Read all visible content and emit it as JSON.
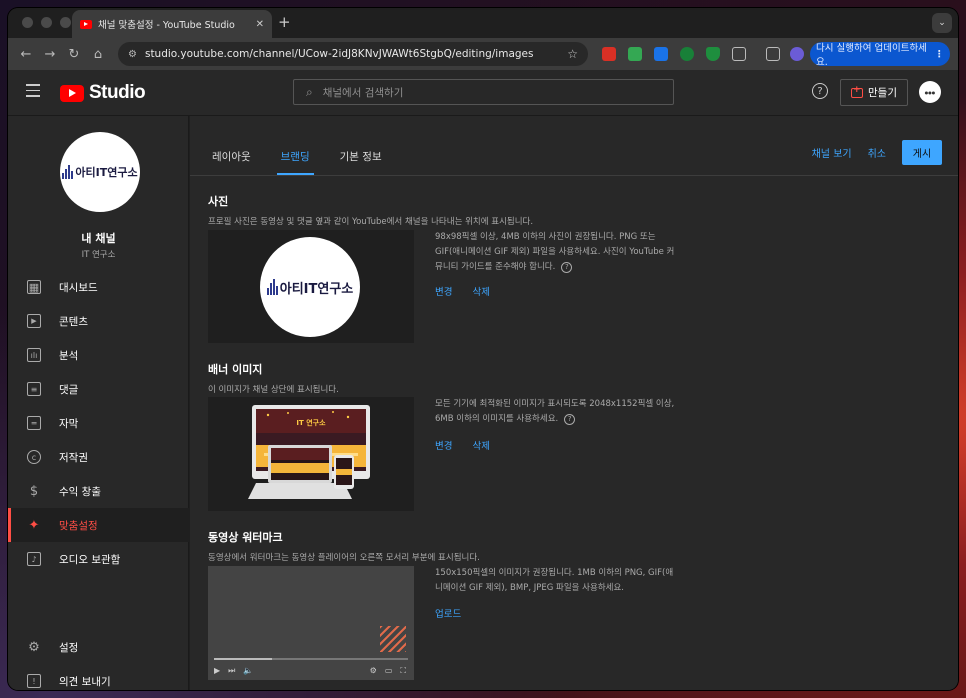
{
  "browser": {
    "tab_title": "채널 맞춤설정 - YouTube Studio",
    "url": "studio.youtube.com/channel/UCow-2idJ8KNvJWAWt6StgbQ/editing/images",
    "update_label": "다시 실행하여 업데이트하세요."
  },
  "header": {
    "logo_text": "Studio",
    "search_placeholder": "채널에서 검색하기",
    "create_label": "만들기"
  },
  "sidebar": {
    "channel_logo_text": "아티IT연구소",
    "channel_name": "내 채널",
    "channel_sub": "IT 연구소",
    "items": [
      {
        "label": "대시보드",
        "icon": "dashboard-icon"
      },
      {
        "label": "콘텐츠",
        "icon": "content-icon"
      },
      {
        "label": "분석",
        "icon": "analytics-icon"
      },
      {
        "label": "댓글",
        "icon": "comments-icon"
      },
      {
        "label": "자막",
        "icon": "subtitles-icon"
      },
      {
        "label": "저작권",
        "icon": "copyright-icon"
      },
      {
        "label": "수익 창출",
        "icon": "monetization-icon"
      },
      {
        "label": "맞춤설정",
        "icon": "customization-icon",
        "active": true
      },
      {
        "label": "오디오 보관함",
        "icon": "audio-library-icon"
      }
    ],
    "bottom": [
      {
        "label": "설정",
        "icon": "settings-icon"
      },
      {
        "label": "의견 보내기",
        "icon": "feedback-icon"
      }
    ]
  },
  "main": {
    "tabs": [
      "레이아웃",
      "브랜딩",
      "기본 정보"
    ],
    "active_tab": "브랜딩",
    "view_channel": "채널 보기",
    "cancel": "취소",
    "publish": "게시",
    "photo": {
      "title": "사진",
      "desc": "프로필 사진은 동영상 및 댓글 옆과 같이 YouTube에서 채널을 나타내는 위치에 표시됩니다.",
      "info": "98x98픽셀 이상, 4MB 이하의 사진이 권장됩니다. PNG 또는 GIF(애니메이션 GIF 제외) 파일을 사용하세요. 사진이 YouTube 커뮤니티 가이드를 준수해야 합니다.",
      "change": "변경",
      "delete": "삭제"
    },
    "banner": {
      "title": "배너 이미지",
      "desc": "이 이미지가 채널 상단에 표시됩니다.",
      "info": "모든 기기에 최적화된 이미지가 표시되도록 2048x1152픽셀 이상, 6MB 이하의 이미지를 사용하세요.",
      "change": "변경",
      "delete": "삭제",
      "preview_text": "IT 연구소"
    },
    "watermark": {
      "title": "동영상 워터마크",
      "desc": "동영상에서 워터마크는 동영상 플레이어의 오른쪽 모서리 부분에 표시됩니다.",
      "info": "150x150픽셀의 이미지가 권장됩니다. 1MB 이하의 PNG, GIF(애니메이션 GIF 제외), BMP, JPEG 파일을 사용하세요.",
      "upload": "업로드"
    }
  },
  "colors": {
    "accent": "#3ea6ff",
    "brand": "#ff0000",
    "active": "#ff4e45"
  }
}
